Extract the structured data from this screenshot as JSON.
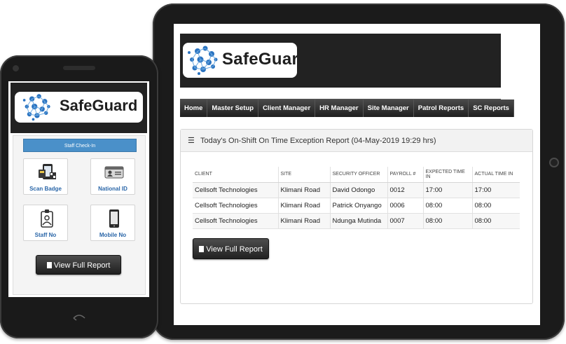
{
  "brand": {
    "name": "SafeGuard"
  },
  "nav": {
    "items": [
      "Home",
      "Master Setup",
      "Client Manager",
      "HR Manager",
      "Site Manager",
      "Patrol Reports",
      "SC Reports"
    ]
  },
  "report": {
    "title": "Today's On-Shift On Time Exception Report (04-May-2019 19:29 hrs)",
    "columns": [
      "CLIENT",
      "SITE",
      "SECURITY OFFICER",
      "PAYROLL #",
      "EXPECTED TIME IN",
      "ACTUAL TIME IN"
    ],
    "rows": [
      [
        "Cellsoft Technologies",
        "Klimani Road",
        "David Odongo",
        "0012",
        "17:00",
        "17:00"
      ],
      [
        "Cellsoft Technologies",
        "Klimani Road",
        "Patrick Onyango",
        "0006",
        "08:00",
        "08:00"
      ],
      [
        "Cellsoft Technologies",
        "Klimani Road",
        "Ndunga Mutinda",
        "0007",
        "08:00",
        "08:00"
      ]
    ],
    "view_full_label": "View Full Report"
  },
  "mobile": {
    "checkin_label": "Staff Check-In",
    "tiles": [
      {
        "label": "Scan Badge",
        "icon": "scan-badge-icon"
      },
      {
        "label": "National ID",
        "icon": "id-card-icon"
      },
      {
        "label": "Staff No",
        "icon": "staff-badge-icon"
      },
      {
        "label": "Mobile No",
        "icon": "mobile-phone-icon"
      }
    ],
    "view_full_label": "View Full Report"
  },
  "colors": {
    "accent": "#4a90c9",
    "tile_label": "#2a66a8",
    "device": "#1a1a1a",
    "banner": "#222222"
  }
}
